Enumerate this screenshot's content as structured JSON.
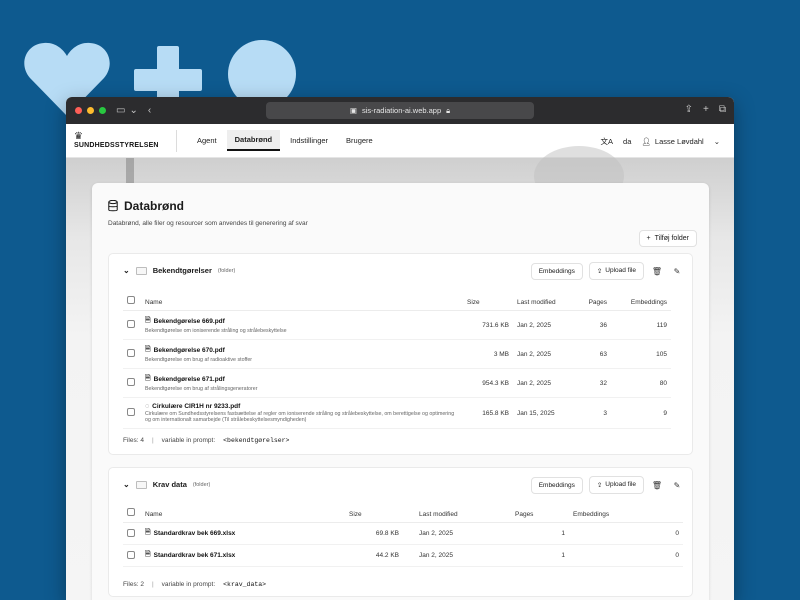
{
  "colors": {
    "background": "#0e5a8f",
    "shape": "#b7dcf5",
    "accent": "#111111"
  },
  "decorative_icons": [
    "heart-icon",
    "plus-icon",
    "circle-icon"
  ],
  "browser": {
    "url": "sis-radiation-ai.web.app"
  },
  "nav": {
    "brand": "SUNDHEDSSTYRELSEN",
    "tabs": [
      {
        "label": "Agent",
        "active": false
      },
      {
        "label": "Databrønd",
        "active": true
      },
      {
        "label": "Indstillinger",
        "active": false
      },
      {
        "label": "Brugere",
        "active": false
      }
    ],
    "language": "da",
    "user": "Lasse Løvdahl"
  },
  "page": {
    "title": "Databrønd",
    "subtitle": "Databrønd, alle filer og resourcer som anvendes til generering af svar",
    "add_folder_label": "Tilføj folder"
  },
  "folders": [
    {
      "name": "Bekendtgørelser",
      "tag": "(folder)",
      "embeddings_label": "Embeddings",
      "upload_label": "Upload file",
      "columns": {
        "name": "Name",
        "size": "Size",
        "last_modified": "Last modified",
        "pages": "Pages",
        "embeddings": "Embeddings"
      },
      "files": [
        {
          "name": "Bekendgørelse 669.pdf",
          "desc": "Bekendtgørelse om ioniserende stråling og strålebeskyttelse",
          "size": "731.6 KB",
          "modified": "Jan 2, 2025",
          "pages": "36",
          "embeddings": "119"
        },
        {
          "name": "Bekendgørelse 670.pdf",
          "desc": "Bekendtgørelse om brug af radioaktive stoffer",
          "size": "3 MB",
          "modified": "Jan 2, 2025",
          "pages": "63",
          "embeddings": "105"
        },
        {
          "name": "Bekendgørelse 671.pdf",
          "desc": "Bekendtgørelse om brug af strålingsgeneratorer",
          "size": "954.3 KB",
          "modified": "Jan 2, 2025",
          "pages": "32",
          "embeddings": "80"
        },
        {
          "name": "Cirkulære CIR1H nr 9233.pdf",
          "desc": "Cirkulære om Sundhedsstyrelsens fastsættelse af regler om ioniserende stråling og strålebeskyttelse, om berettigelse og optimering og om internationalt samarbejde (Til strålebeskyttelsesmyndigheden)",
          "size": "165.8 KB",
          "modified": "Jan 15, 2025",
          "pages": "3",
          "embeddings": "9"
        }
      ],
      "files_count_label": "Files: 4",
      "variable_label": "variable in prompt:",
      "variable": "<bekendtgørelser>"
    },
    {
      "name": "Krav data",
      "tag": "(folder)",
      "embeddings_label": "Embeddings",
      "upload_label": "Upload file",
      "columns": {
        "name": "Name",
        "size": "Size",
        "last_modified": "Last modified",
        "pages": "Pages",
        "embeddings": "Embeddings"
      },
      "files": [
        {
          "name": "Standardkrav bek 669.xlsx",
          "size": "69.8 KB",
          "modified": "Jan 2, 2025",
          "pages": "1",
          "embeddings": "0"
        },
        {
          "name": "Standardkrav bek 671.xlsx",
          "size": "44.2 KB",
          "modified": "Jan 2, 2025",
          "pages": "1",
          "embeddings": "0"
        }
      ],
      "files_count_label": "Files: 2",
      "variable_label": "variable in prompt:",
      "variable": "<krav_data>"
    }
  ]
}
